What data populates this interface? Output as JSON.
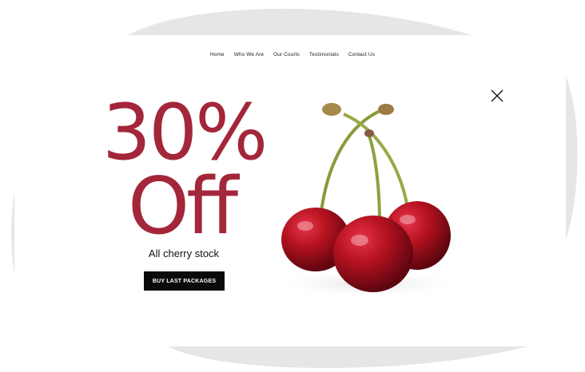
{
  "nav": {
    "items": [
      "Home",
      "Who We Are",
      "Our Courts",
      "Testimonials",
      "Contact Us"
    ]
  },
  "promo": {
    "percent": "30%",
    "off": "Off",
    "subtitle": "All cherry stock",
    "button_label": "BUY LAST PACKAGES"
  },
  "colors": {
    "accent": "#a3263a",
    "button_bg": "#0a0a0a",
    "blob": "#e6e6e6"
  },
  "icons": {
    "close": "close-icon",
    "image": "cherries-image"
  }
}
